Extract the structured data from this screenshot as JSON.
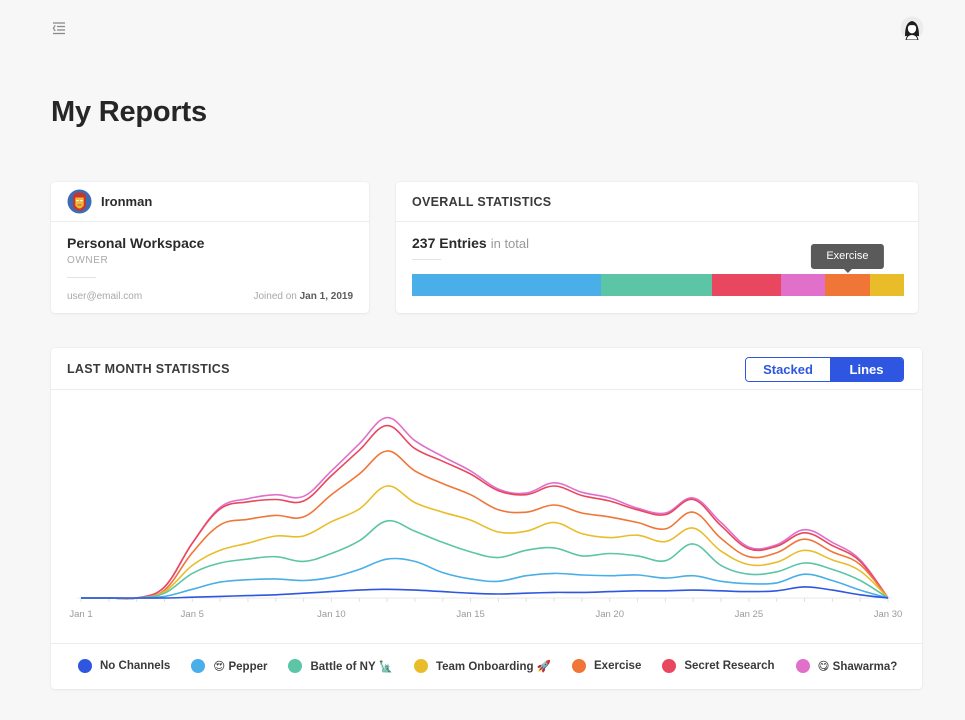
{
  "header": {
    "menu_icon": "collapse-menu-icon",
    "avatar_icon": "user-avatar-icon"
  },
  "page_title": "My Reports",
  "workspace": {
    "user": "Ironman",
    "avatar_icon": "ironman-avatar-icon",
    "name": "Personal Workspace",
    "role": "OWNER",
    "email": "user@email.com",
    "joined_label": "Joined on",
    "joined_date": "Jan 1, 2019"
  },
  "overall": {
    "title": "OVERALL STATISTICS",
    "entries": "237 Entries",
    "entries_suffix": "in total",
    "tooltip": "Exercise",
    "segments": [
      {
        "name": "Pepper",
        "fraction": 0.385,
        "color": "#4aaee8"
      },
      {
        "name": "Battle of NY",
        "fraction": 0.225,
        "color": "#5cc5a6"
      },
      {
        "name": "Secret Research",
        "fraction": 0.14,
        "color": "#e8475f"
      },
      {
        "name": "Shawarma?",
        "fraction": 0.09,
        "color": "#e070c9"
      },
      {
        "name": "Exercise",
        "fraction": 0.09,
        "color": "#f07638"
      },
      {
        "name": "Team Onboarding",
        "fraction": 0.07,
        "color": "#e9bd2a"
      }
    ]
  },
  "last_month": {
    "title": "LAST MONTH STATISTICS",
    "toggle": {
      "stacked": "Stacked",
      "lines": "Lines",
      "active": "lines"
    }
  },
  "legend": [
    {
      "label": "No Channels",
      "color": "#2e56e0"
    },
    {
      "label": "😍 Pepper",
      "color": "#4aaee8"
    },
    {
      "label": "Battle of NY 🗽",
      "color": "#5cc5a6"
    },
    {
      "label": "Team Onboarding 🚀",
      "color": "#e9bd2a"
    },
    {
      "label": "Exercise",
      "color": "#f07638"
    },
    {
      "label": "Secret Research",
      "color": "#e8475f"
    },
    {
      "label": "😋 Shawarma?",
      "color": "#e070c9"
    }
  ],
  "chart_data": {
    "type": "line",
    "stacked": true,
    "x": [
      1,
      2,
      3,
      4,
      5,
      6,
      7,
      8,
      9,
      10,
      11,
      12,
      13,
      14,
      15,
      16,
      17,
      18,
      19,
      20,
      21,
      22,
      23,
      24,
      25,
      26,
      27,
      28,
      29,
      30
    ],
    "x_tick_labels": [
      "Jan 1",
      "Jan 5",
      "Jan 10",
      "Jan 15",
      "Jan 20",
      "Jan 25",
      "Jan 30"
    ],
    "x_tick_values": [
      1,
      5,
      10,
      15,
      20,
      25,
      30
    ],
    "grid": false,
    "legend_position": "bottom",
    "series": [
      {
        "name": "No Channels",
        "color": "#2e56e0",
        "values": [
          0,
          0,
          0,
          0,
          0.5,
          1,
          1.5,
          2,
          3,
          4,
          5,
          5.5,
          5,
          4,
          3,
          2.5,
          3,
          3.5,
          3.5,
          4,
          4.5,
          4.5,
          5,
          4.5,
          4,
          4.5,
          7,
          5,
          2,
          0
        ]
      },
      {
        "name": "😍 Pepper",
        "color": "#4aaee8",
        "values": [
          0,
          0,
          0,
          1,
          5,
          9,
          10,
          10,
          8,
          9,
          13,
          19,
          18,
          12,
          9,
          8,
          11,
          12,
          11,
          10,
          10,
          8,
          9,
          6,
          5,
          5,
          8,
          6,
          3,
          0
        ]
      },
      {
        "name": "Battle of NY 🗽",
        "color": "#5cc5a6",
        "values": [
          0,
          0,
          0,
          2,
          10,
          12,
          13,
          14,
          12,
          15,
          18,
          24,
          19,
          19,
          17,
          15,
          16,
          16,
          12,
          14,
          12,
          11,
          20,
          10,
          6,
          7,
          7,
          7,
          6,
          0
        ]
      },
      {
        "name": "Team Onboarding 🚀",
        "color": "#e9bd2a",
        "values": [
          0,
          0,
          0,
          1,
          5,
          8,
          10,
          13,
          16,
          20,
          20,
          22,
          18,
          19,
          20,
          16,
          12,
          16,
          14,
          10,
          13,
          12,
          10,
          9,
          6,
          6,
          8,
          6,
          6,
          0
        ]
      },
      {
        "name": "Exercise",
        "color": "#f07638",
        "values": [
          0,
          0,
          0,
          1,
          8,
          16,
          15,
          13,
          12,
          17,
          22,
          22,
          20,
          18,
          16,
          14,
          12,
          11,
          13,
          13,
          8,
          8,
          10,
          8,
          5,
          6,
          7,
          5,
          4,
          0
        ]
      },
      {
        "name": "Secret Research",
        "color": "#e8475f",
        "values": [
          0,
          0,
          0,
          2,
          6,
          10,
          11,
          10,
          10,
          12,
          15,
          16,
          14,
          14,
          13,
          12,
          11,
          12,
          11,
          10,
          8,
          9,
          8,
          8,
          5,
          4,
          4,
          4,
          2,
          0
        ]
      },
      {
        "name": "😋 Shawarma?",
        "color": "#e070c9",
        "values": [
          0,
          0,
          0,
          0,
          0,
          1,
          2,
          3,
          3,
          3,
          4,
          5,
          5,
          3,
          2,
          1,
          1,
          2,
          2,
          2,
          1,
          1,
          1,
          2,
          1,
          1,
          2,
          2,
          1,
          0
        ]
      }
    ]
  }
}
